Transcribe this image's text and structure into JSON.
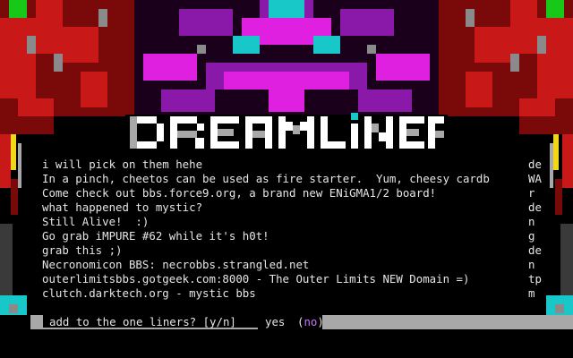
{
  "logo": {
    "text": "DREAMLINER",
    "colors": {
      "main": "#ffffff",
      "shadow": "#a8a8a8",
      "accent": "#00c8c8"
    }
  },
  "palette": {
    "red": "#c81818",
    "dark_red": "#7a0a0a",
    "magenta": "#e020e0",
    "purple": "#8a18a8",
    "cyan": "#18c8c8",
    "gray": "#8a8a8a",
    "yellow": "#f0d818",
    "green": "#18c818"
  },
  "oneliners": [
    {
      "text": "i will pick on them hehe",
      "author": "de"
    },
    {
      "text": "In a pinch, cheetos can be used as fire starter.  Yum, cheesy cardb",
      "author": "WA"
    },
    {
      "text": "Come check out bbs.force9.org, a brand new ENiGMA1/2 board!",
      "author": "r"
    },
    {
      "text": "what happened to mystic?",
      "author": "de"
    },
    {
      "text": "Still Alive!  :)",
      "author": "n"
    },
    {
      "text": "Go grab iMPURE #62 while it's h0t!",
      "author": "g"
    },
    {
      "text": "grab this ;)",
      "author": "de"
    },
    {
      "text": "Necronomicon BBS: necrobbs.strangled.net",
      "author": "n"
    },
    {
      "text": "outerlimitsbbs.gotgeek.com:8000 - The Outer Limits NEW Domain =)",
      "author": "tp"
    },
    {
      "text": "clutch.darktech.org - mystic bbs",
      "author": "m"
    }
  ],
  "prompt": {
    "question": "add to the one liners? ",
    "keys": "[y/n]",
    "yes_label": "yes",
    "no_label": "no",
    "no_open": "(",
    "no_close": ")"
  }
}
